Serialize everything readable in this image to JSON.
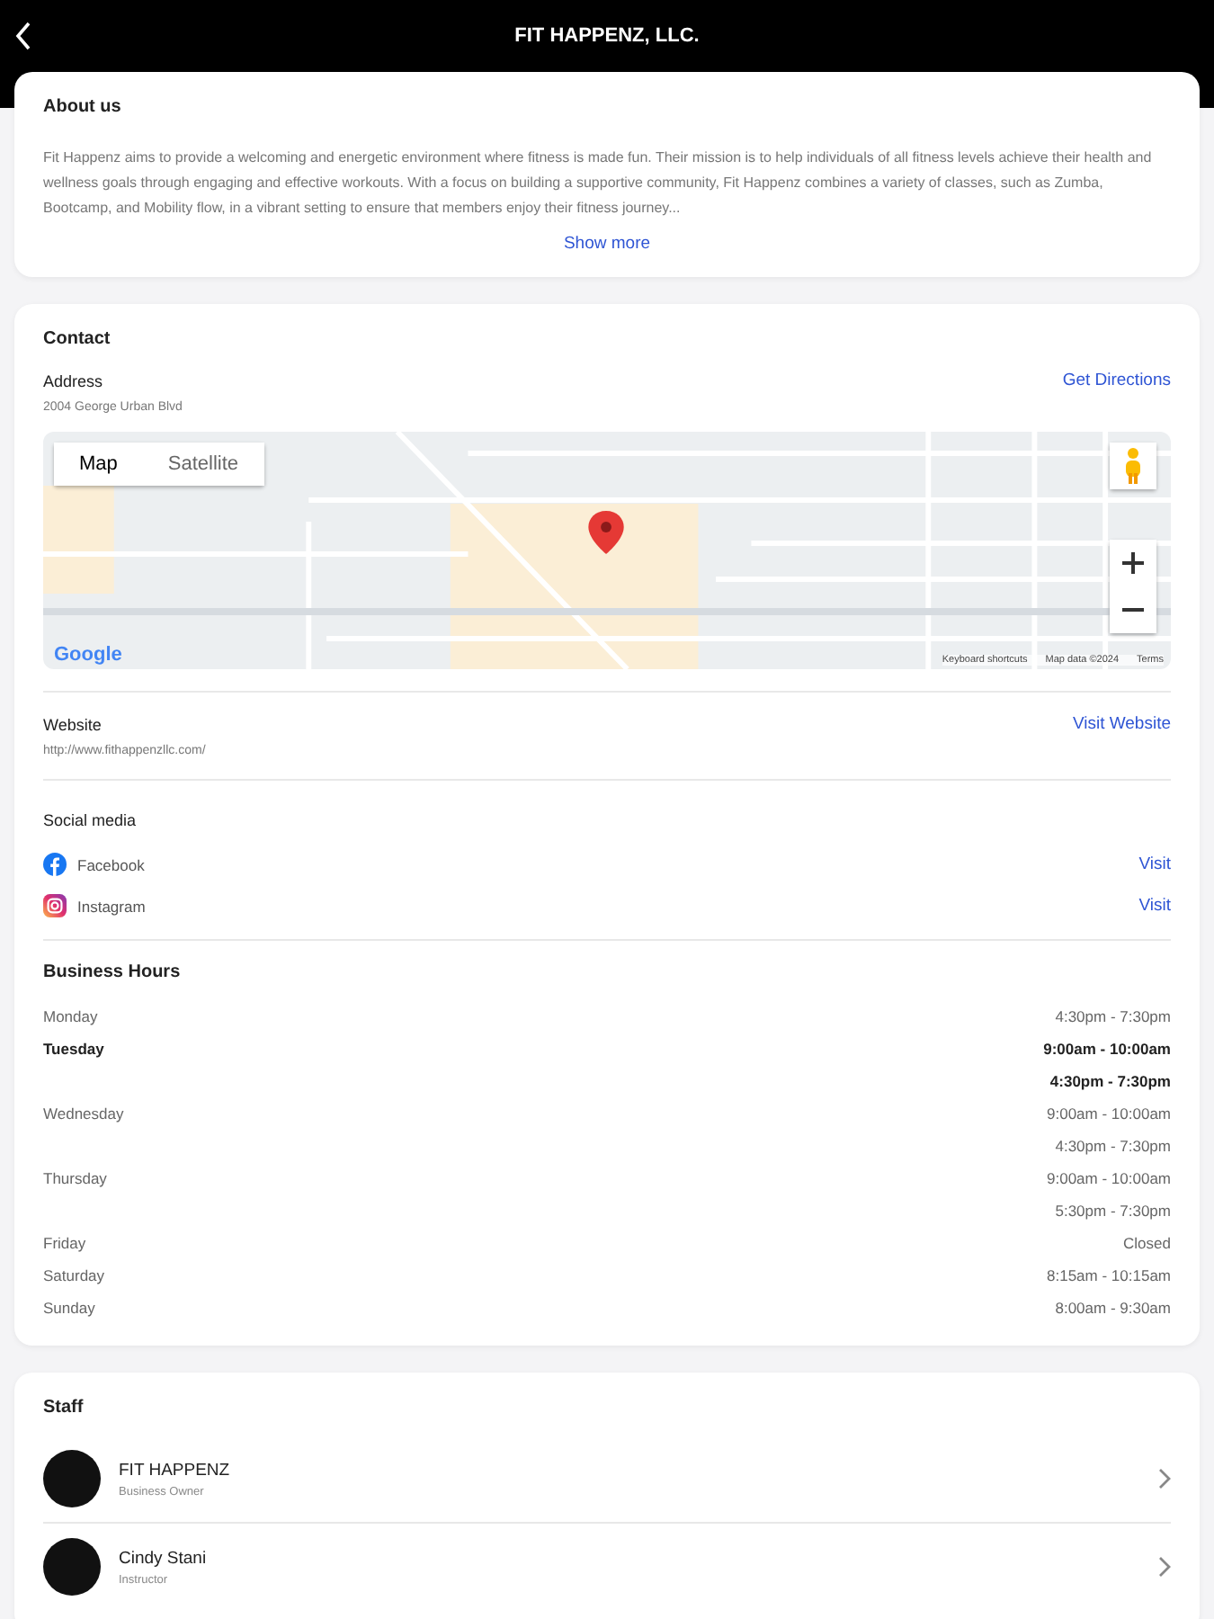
{
  "header": {
    "title": "FIT HAPPENZ, LLC."
  },
  "about": {
    "heading": "About us",
    "text": "Fit Happenz aims to provide a welcoming and energetic environment where fitness is made fun. Their mission is to help individuals of all fitness levels achieve their health and wellness goals through engaging and effective workouts. With a focus on building a supportive community, Fit Happenz combines a variety of classes, such as Zumba, Bootcamp, and Mobility flow, in a vibrant setting to ensure that members enjoy their fitness journey...",
    "show_more": "Show more"
  },
  "contact": {
    "heading": "Contact",
    "address": {
      "label": "Address",
      "value": "2004 George Urban Blvd",
      "action": "Get Directions"
    },
    "map": {
      "types": [
        {
          "label": "Map",
          "selected": true
        },
        {
          "label": "Satellite",
          "selected": false
        }
      ],
      "logo": "Google",
      "attribution": [
        "Keyboard shortcuts",
        "Map data ©2024",
        "Terms"
      ]
    },
    "website": {
      "label": "Website",
      "value": "http://www.fithappenzllc.com/",
      "action": "Visit Website"
    },
    "social": {
      "label": "Social media",
      "items": [
        {
          "kind": "facebook",
          "name": "Facebook",
          "action": "Visit"
        },
        {
          "kind": "instagram",
          "name": "Instagram",
          "action": "Visit"
        }
      ]
    },
    "hours": {
      "label": "Business Hours",
      "days": [
        {
          "day": "Monday",
          "today": false,
          "times": [
            "4:30pm - 7:30pm"
          ]
        },
        {
          "day": "Tuesday",
          "today": true,
          "times": [
            "9:00am - 10:00am",
            "4:30pm - 7:30pm"
          ]
        },
        {
          "day": "Wednesday",
          "today": false,
          "times": [
            "9:00am - 10:00am",
            "4:30pm - 7:30pm"
          ]
        },
        {
          "day": "Thursday",
          "today": false,
          "times": [
            "9:00am - 10:00am",
            "5:30pm - 7:30pm"
          ]
        },
        {
          "day": "Friday",
          "today": false,
          "times": [
            "Closed"
          ]
        },
        {
          "day": "Saturday",
          "today": false,
          "times": [
            "8:15am - 10:15am"
          ]
        },
        {
          "day": "Sunday",
          "today": false,
          "times": [
            "8:00am - 9:30am"
          ]
        }
      ]
    }
  },
  "staff": {
    "heading": "Staff",
    "members": [
      {
        "name": "FIT HAPPENZ",
        "role": "Business Owner"
      },
      {
        "name": "Cindy Stani",
        "role": "Instructor"
      }
    ]
  }
}
